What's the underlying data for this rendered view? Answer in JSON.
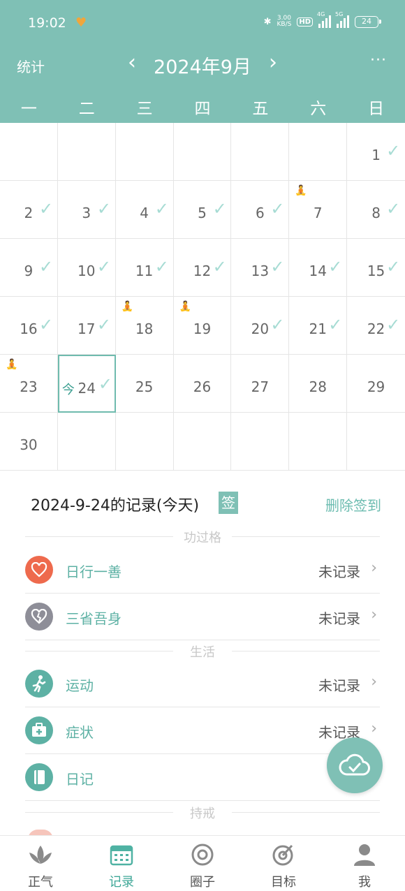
{
  "status_bar": {
    "time": "19:02",
    "net_speed_value": "3.00",
    "net_speed_unit": "KB/S",
    "hd_label": "HD",
    "sim1_label": "4G",
    "sim2_label": "5G",
    "battery": "24"
  },
  "header": {
    "stats_label": "统计",
    "prev_icon": "‹",
    "month_title": "2024年9月",
    "next_icon": "›",
    "more_icon": "···"
  },
  "weekdays": [
    "一",
    "二",
    "三",
    "四",
    "五",
    "六",
    "日"
  ],
  "calendar": {
    "weeks": [
      [
        {
          "day": ""
        },
        {
          "day": ""
        },
        {
          "day": ""
        },
        {
          "day": ""
        },
        {
          "day": ""
        },
        {
          "day": ""
        },
        {
          "day": "1",
          "checked": true
        }
      ],
      [
        {
          "day": "2",
          "checked": true
        },
        {
          "day": "3",
          "checked": true
        },
        {
          "day": "4",
          "checked": true
        },
        {
          "day": "5",
          "checked": true
        },
        {
          "day": "6",
          "checked": true
        },
        {
          "day": "7",
          "yoga": true
        },
        {
          "day": "8",
          "checked": true
        }
      ],
      [
        {
          "day": "9",
          "checked": true
        },
        {
          "day": "10",
          "checked": true
        },
        {
          "day": "11",
          "checked": true
        },
        {
          "day": "12",
          "checked": true
        },
        {
          "day": "13",
          "checked": true
        },
        {
          "day": "14",
          "checked": true
        },
        {
          "day": "15",
          "checked": true
        }
      ],
      [
        {
          "day": "16",
          "checked": true
        },
        {
          "day": "17",
          "checked": true
        },
        {
          "day": "18",
          "yoga": true
        },
        {
          "day": "19",
          "yoga": true
        },
        {
          "day": "20",
          "checked": true
        },
        {
          "day": "21",
          "checked": true
        },
        {
          "day": "22",
          "checked": true
        }
      ],
      [
        {
          "day": "23",
          "yoga": true
        },
        {
          "day": "24",
          "checked": true,
          "today": true
        },
        {
          "day": "25"
        },
        {
          "day": "26"
        },
        {
          "day": "27"
        },
        {
          "day": "28"
        },
        {
          "day": "29"
        }
      ],
      [
        {
          "day": "30"
        },
        {
          "day": ""
        },
        {
          "day": ""
        },
        {
          "day": ""
        },
        {
          "day": ""
        },
        {
          "day": ""
        },
        {
          "day": ""
        }
      ]
    ],
    "today_mark": "今",
    "check_glyph": "✓",
    "yoga_glyph": "🧘",
    "icon_names": {
      "check": "check-icon",
      "yoga": "meditation-icon"
    }
  },
  "record": {
    "title": "2024-9-24的记录(今天)",
    "sign_badge": "签",
    "delete_label": "删除签到"
  },
  "sections": {
    "merits": "功过格",
    "life": "生活",
    "precepts": "持戒"
  },
  "rows": {
    "good_deed": {
      "label": "日行一善",
      "value": "未记录",
      "color": "#ee6a4d"
    },
    "reflect": {
      "label": "三省吾身",
      "value": "未记录",
      "color": "#8e8e98"
    },
    "exercise": {
      "label": "运动",
      "value": "未记录",
      "color": "#5db1a4"
    },
    "symptom": {
      "label": "症状",
      "value": "未记录",
      "color": "#5db1a4"
    },
    "diary": {
      "label": "日记",
      "value": "未",
      "color": "#5db1a4"
    }
  },
  "tabs": {
    "zhengqi": "正气",
    "record": "记录",
    "circle": "圈子",
    "goal": "目标",
    "me": "我"
  },
  "colors": {
    "primary": "#7fc0b5",
    "accent_text": "#3ea797",
    "check": "#a7dcd4",
    "yoga": "#c98fd8"
  }
}
